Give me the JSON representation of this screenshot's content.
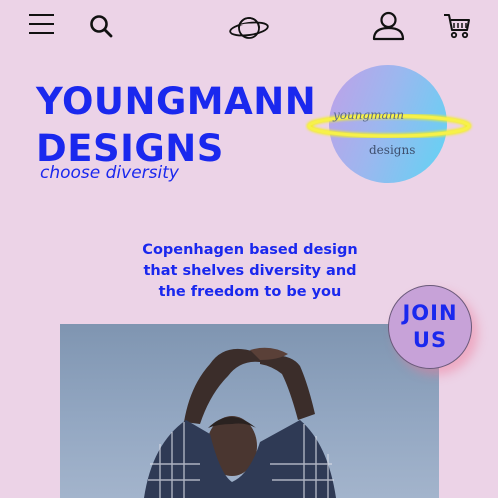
{
  "header": {
    "icons": [
      "menu-icon",
      "search-icon",
      "planet-icon",
      "user-icon",
      "cart-icon"
    ]
  },
  "brand": {
    "title_line1": "YOUNGMANN",
    "title_line2": "DESIGNS",
    "tagline": "choose diversity",
    "logo_word1": "youngmann",
    "logo_word2": "designs"
  },
  "about": {
    "line1": "Copenhagen based design",
    "line2": "that shelves diversity and",
    "line3": "the freedom to be you"
  },
  "cta": {
    "line1": "JOIN",
    "line2": "US"
  },
  "colors": {
    "background": "#ecd3e7",
    "accent": "#1a28ee",
    "cta_fill": "#c7a2d8",
    "ring": "#f4f020"
  }
}
